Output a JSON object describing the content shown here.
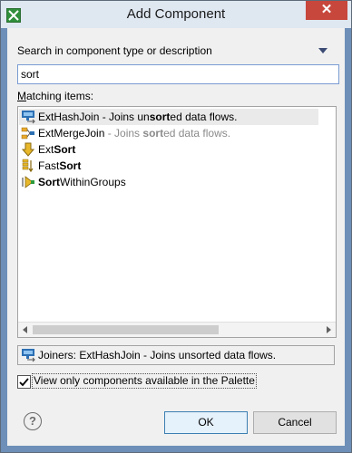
{
  "window": {
    "title": "Add Component",
    "close_label": "✕"
  },
  "search": {
    "label": "Search in component type or description",
    "value": "sort"
  },
  "matching": {
    "label": "Matching items:"
  },
  "items": [
    {
      "icon": "hash-join-icon",
      "pre": "ExtHashJoin - Joins un",
      "bold": "sort",
      "post": "ed data flows.",
      "gray": false
    },
    {
      "icon": "merge-join-icon",
      "pre": "ExtMergeJoin - Joins ",
      "bold": "sort",
      "post": "ed data flows.",
      "gray": true
    },
    {
      "icon": "ext-sort-icon",
      "pre": "Ext",
      "bold": "Sort",
      "post": "",
      "gray": false
    },
    {
      "icon": "fast-sort-icon",
      "pre": "Fast",
      "bold": "Sort",
      "post": "",
      "gray": false
    },
    {
      "icon": "sort-within-groups-icon",
      "pre": "",
      "bold": "Sort",
      "post": "WithinGroups",
      "gray": false
    }
  ],
  "status": {
    "text": "Joiners: ExtHashJoin - Joins unsorted data flows."
  },
  "palette_checkbox": {
    "label": "View only components available in the Palette",
    "checked": true
  },
  "buttons": {
    "ok": "OK",
    "cancel": "Cancel",
    "help": "?"
  }
}
